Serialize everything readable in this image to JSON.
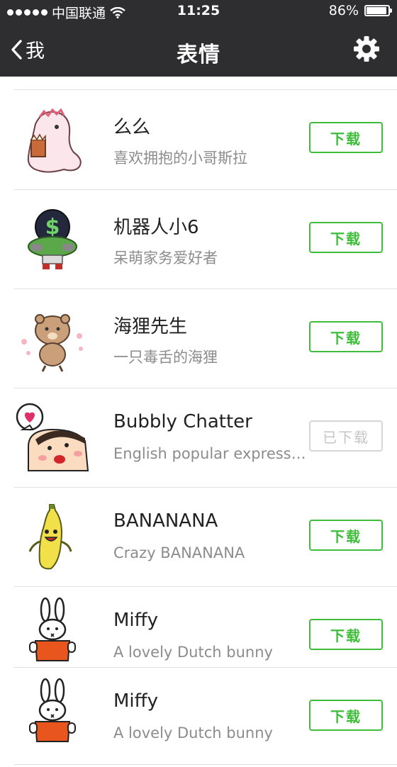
{
  "status_bar": {
    "carrier": "中国联通",
    "time": "11:25",
    "battery": "86%",
    "battery_level": 0.86
  },
  "nav": {
    "back_label": "我",
    "title": "表情"
  },
  "colors": {
    "nav_background": "#2e2e30",
    "accent_green": "#3fbc3a",
    "disabled_gray": "#c6c6c6"
  },
  "stickers": [
    {
      "name": "么么",
      "description": "喜欢拥抱的小哥斯拉",
      "button": "下载",
      "downloaded": false,
      "icon": "pink-dinosaur-icon"
    },
    {
      "name": "机器人小6",
      "description": "呆萌家务爱好者",
      "button": "下载",
      "downloaded": false,
      "icon": "money-robot-icon"
    },
    {
      "name": "海狸先生",
      "description": "一只毒舌的海狸",
      "button": "下载",
      "downloaded": false,
      "icon": "beaver-icon"
    },
    {
      "name": "Bubbly Chatter",
      "description": "English popular expressions",
      "button": "已下载",
      "downloaded": true,
      "icon": "bubbly-chatter-icon"
    },
    {
      "name": "BANANANA",
      "description": "Crazy BANANANA",
      "button": "下载",
      "downloaded": false,
      "icon": "banana-icon"
    },
    {
      "name": "Miffy",
      "description": "A lovely Dutch bunny",
      "button": "下载",
      "downloaded": false,
      "icon": "miffy-bunny-icon"
    },
    {
      "name": "Miffy",
      "description": "A lovely Dutch bunny",
      "button": "下载",
      "downloaded": false,
      "icon": "miffy-bunny-icon"
    }
  ]
}
